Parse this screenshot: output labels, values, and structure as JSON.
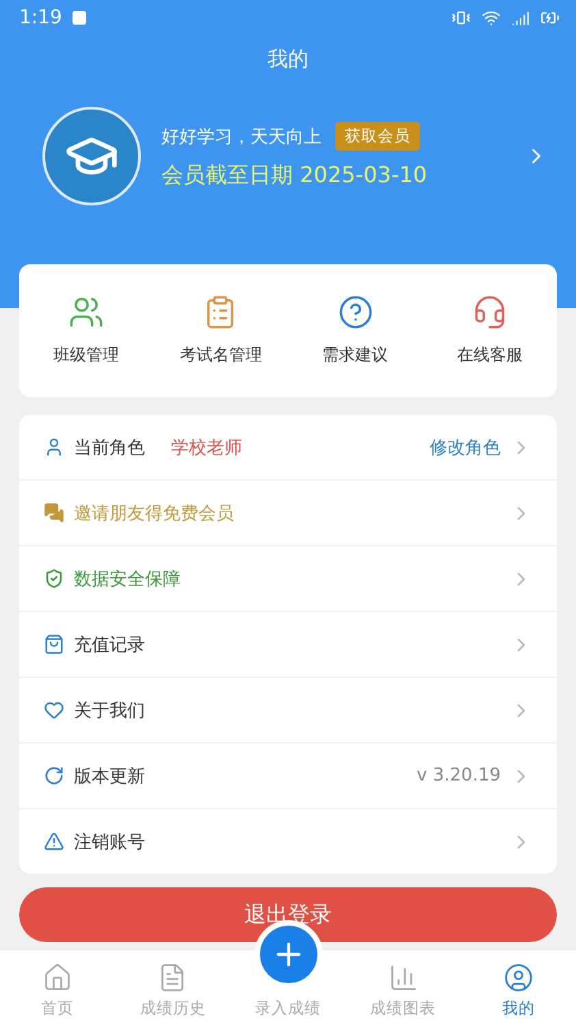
{
  "status_bar": {
    "time": "1:19"
  },
  "header": {
    "title": "我的"
  },
  "profile": {
    "motto": "好好学习，天天向上",
    "badge": "获取会员",
    "expiry": "会员截至日期 2025-03-10"
  },
  "tools": [
    {
      "label": "班级管理",
      "color": "#4caf50"
    },
    {
      "label": "考试名管理",
      "color": "#d9954a"
    },
    {
      "label": "需求建议",
      "color": "#2a7fd1"
    },
    {
      "label": "在线客服",
      "color": "#e0605a"
    }
  ],
  "menu": [
    {
      "label": "当前角色",
      "color": "#333333",
      "value": "学校老师",
      "action": "修改角色"
    },
    {
      "label": "邀请朋友得免费会员",
      "color": "#c09a3a"
    },
    {
      "label": "数据安全保障",
      "color": "#3a9a3a"
    },
    {
      "label": "充值记录",
      "color": "#333333"
    },
    {
      "label": "关于我们",
      "color": "#333333"
    },
    {
      "label": "版本更新",
      "color": "#333333",
      "value": "v 3.20.19"
    },
    {
      "label": "注销账号",
      "color": "#333333"
    }
  ],
  "logout_button": "退出登录",
  "nav": [
    {
      "label": "首页",
      "kind": "tab",
      "selected": false
    },
    {
      "label": "成绩历史",
      "kind": "tab",
      "selected": false
    },
    {
      "label": "录入成绩",
      "kind": "fab",
      "selected": false
    },
    {
      "label": "成绩图表",
      "kind": "tab",
      "selected": false
    },
    {
      "label": "我的",
      "kind": "tab",
      "selected": true
    }
  ]
}
